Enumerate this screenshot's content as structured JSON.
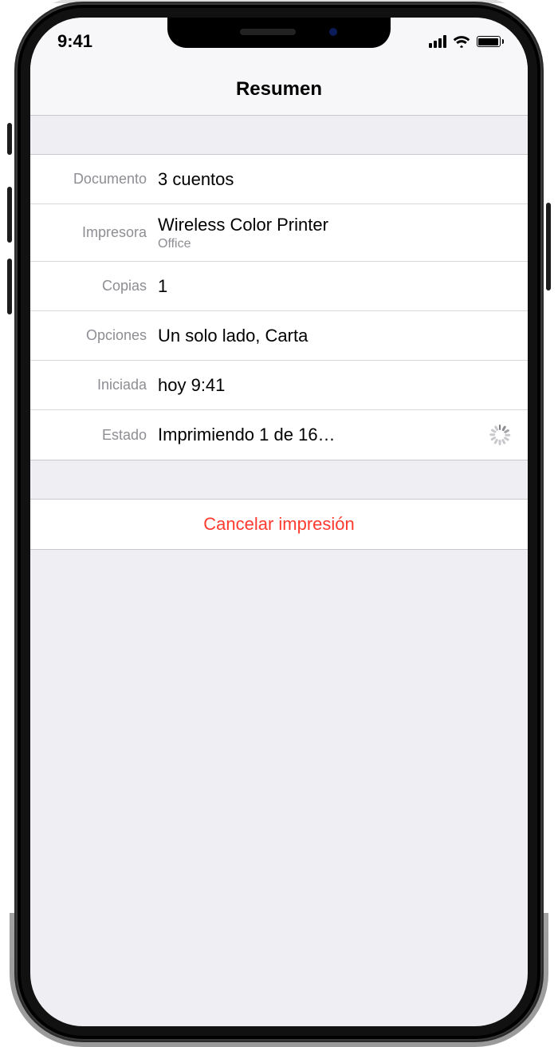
{
  "status_bar": {
    "time": "9:41"
  },
  "header": {
    "title": "Resumen"
  },
  "labels": {
    "document": "Documento",
    "printer": "Impresora",
    "copies": "Copias",
    "options": "Opciones",
    "started": "Iniciada",
    "status": "Estado"
  },
  "values": {
    "document": "3 cuentos",
    "printer_name": "Wireless Color Printer",
    "printer_location": "Office",
    "copies": "1",
    "options": "Un solo lado, Carta",
    "started": "hoy 9:41",
    "status": "Imprimiendo 1 de 16…"
  },
  "actions": {
    "cancel": "Cancelar impresión"
  }
}
